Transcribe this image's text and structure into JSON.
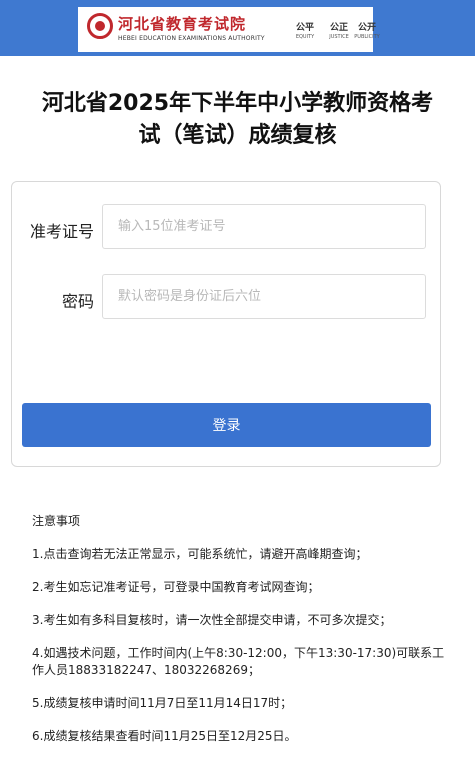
{
  "header": {
    "logo_cn": "河北省教育考试院",
    "logo_en": "HEBEI EDUCATION EXAMINATIONS AUTHORITY",
    "mottos": [
      {
        "cn": "公平",
        "en": "EQUITY"
      },
      {
        "cn": "公正",
        "en": "JUSTICE"
      },
      {
        "cn": "公开",
        "en": "PUBLICITY"
      }
    ],
    "bar_color": "#3f79d0"
  },
  "title_line1": "河北省2025年下半年中小学教师资格考",
  "title_line2": "试（笔试）成绩复核",
  "form": {
    "exam_id_label": "准考证号",
    "exam_id_placeholder": "输入15位准考证号",
    "exam_id_value": "",
    "password_label": "密码",
    "password_placeholder": "默认密码是身份证后六位",
    "password_value": "",
    "login_label": "登录",
    "button_color": "#3a73d0"
  },
  "notes": {
    "heading": "注意事项",
    "items": [
      "1.点击查询若无法正常显示，可能系统忙，请避开高峰期查询；",
      "2.考生如忘记准考证号，可登录中国教育考试网查询；",
      "3.考生如有多科目复核时，请一次性全部提交申请，不可多次提交；",
      "4.如遇技术问题，工作时间内(上午8:30-12:00，下午13:30-17:30)可联系工作人员18833182247、18032268269；",
      "5.成绩复核申请时间11月7日至11月14日17时；",
      "6.成绩复核结果查看时间11月25日至12月25日。"
    ]
  }
}
